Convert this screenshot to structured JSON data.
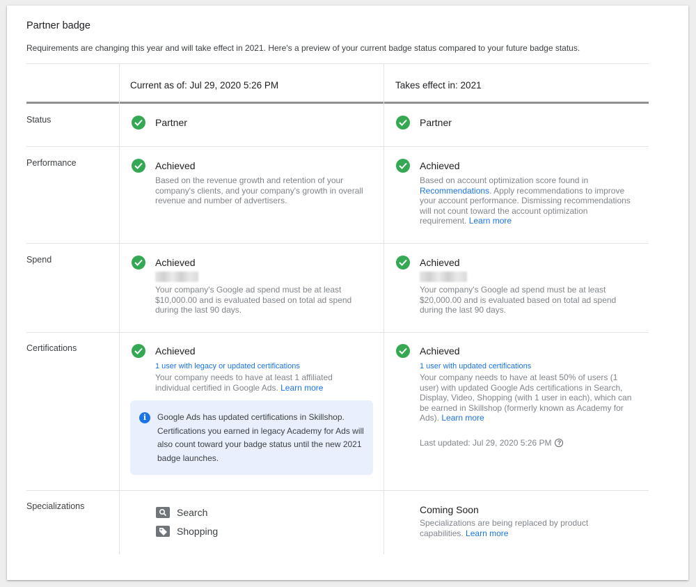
{
  "title": "Partner badge",
  "subtitle": "Requirements are changing this year and will take effect in 2021. Here's a preview of your current badge status compared to your future badge status.",
  "columns": {
    "current": "Current as of: Jul 29, 2020 5:26 PM",
    "future": "Takes effect in: 2021"
  },
  "rows": {
    "status": {
      "label": "Status",
      "current": "Partner",
      "future": "Partner"
    },
    "performance": {
      "label": "Performance",
      "current": {
        "status": "Achieved",
        "desc": "Based on the revenue growth and retention of your company's clients, and your company's growth in overall revenue and number of advertisers."
      },
      "future": {
        "status": "Achieved",
        "desc_pre": "Based on account optimization score found in ",
        "desc_link": "Recommendations",
        "desc_post": ". Apply recommendations to improve your account performance. Dismissing recommendations will not count toward the account optimization requirement. ",
        "learn_more": "Learn more"
      }
    },
    "spend": {
      "label": "Spend",
      "current": {
        "status": "Achieved",
        "desc": "Your company's Google ad spend must be at least $10,000.00 and is evaluated based on total ad spend during the last 90 days."
      },
      "future": {
        "status": "Achieved",
        "desc": "Your company's Google ad spend must be at least $20,000.00 and is evaluated based on total ad spend during the last 90 days."
      }
    },
    "certifications": {
      "label": "Certifications",
      "current": {
        "status": "Achieved",
        "link": "1 user with legacy or updated certifications",
        "desc": "Your company needs to have at least 1 affiliated individual certified in Google Ads. ",
        "learn_more": "Learn more",
        "info": "Google Ads has updated certifications in Skillshop. Certifications you earned in legacy Academy for Ads will also count toward your badge status until the new 2021 badge launches."
      },
      "future": {
        "status": "Achieved",
        "link": "1 user with updated certifications",
        "desc": "Your company needs to have at least 50% of users (1 user) with updated Google Ads certifications in Search, Display, Video, Shopping (with 1 user in each), which can be earned in Skillshop (formerly known as Academy for Ads). ",
        "learn_more": "Learn more",
        "last_updated": "Last updated: Jul 29, 2020 5:26 PM"
      }
    },
    "specializations": {
      "label": "Specializations",
      "current": [
        "Search",
        "Shopping"
      ],
      "future": {
        "title": "Coming Soon",
        "desc": "Specializations are being replaced by product capabilities. ",
        "learn_more": "Learn more"
      }
    }
  },
  "colors": {
    "check": "#34a853",
    "link": "#1a73e8",
    "info_bg": "#e8f0fe"
  },
  "icons": {
    "status": "check-circle-icon",
    "info": "info-icon",
    "help": "help-circle-icon",
    "search": "search-icon",
    "shopping": "tag-icon"
  }
}
